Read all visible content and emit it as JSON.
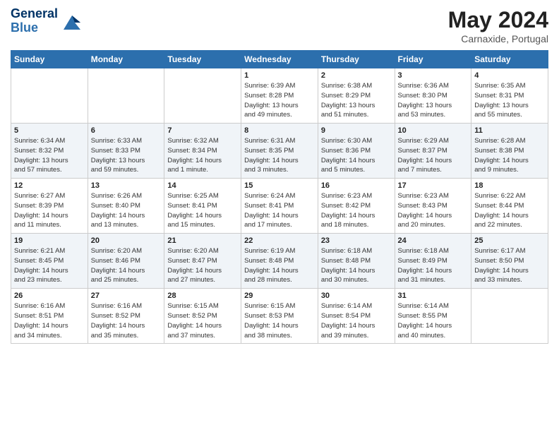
{
  "header": {
    "logo_line1": "General",
    "logo_line2": "Blue",
    "month": "May 2024",
    "location": "Carnaxide, Portugal"
  },
  "days_of_week": [
    "Sunday",
    "Monday",
    "Tuesday",
    "Wednesday",
    "Thursday",
    "Friday",
    "Saturday"
  ],
  "weeks": [
    [
      {
        "day": "",
        "info": ""
      },
      {
        "day": "",
        "info": ""
      },
      {
        "day": "",
        "info": ""
      },
      {
        "day": "1",
        "info": "Sunrise: 6:39 AM\nSunset: 8:28 PM\nDaylight: 13 hours\nand 49 minutes."
      },
      {
        "day": "2",
        "info": "Sunrise: 6:38 AM\nSunset: 8:29 PM\nDaylight: 13 hours\nand 51 minutes."
      },
      {
        "day": "3",
        "info": "Sunrise: 6:36 AM\nSunset: 8:30 PM\nDaylight: 13 hours\nand 53 minutes."
      },
      {
        "day": "4",
        "info": "Sunrise: 6:35 AM\nSunset: 8:31 PM\nDaylight: 13 hours\nand 55 minutes."
      }
    ],
    [
      {
        "day": "5",
        "info": "Sunrise: 6:34 AM\nSunset: 8:32 PM\nDaylight: 13 hours\nand 57 minutes."
      },
      {
        "day": "6",
        "info": "Sunrise: 6:33 AM\nSunset: 8:33 PM\nDaylight: 13 hours\nand 59 minutes."
      },
      {
        "day": "7",
        "info": "Sunrise: 6:32 AM\nSunset: 8:34 PM\nDaylight: 14 hours\nand 1 minute."
      },
      {
        "day": "8",
        "info": "Sunrise: 6:31 AM\nSunset: 8:35 PM\nDaylight: 14 hours\nand 3 minutes."
      },
      {
        "day": "9",
        "info": "Sunrise: 6:30 AM\nSunset: 8:36 PM\nDaylight: 14 hours\nand 5 minutes."
      },
      {
        "day": "10",
        "info": "Sunrise: 6:29 AM\nSunset: 8:37 PM\nDaylight: 14 hours\nand 7 minutes."
      },
      {
        "day": "11",
        "info": "Sunrise: 6:28 AM\nSunset: 8:38 PM\nDaylight: 14 hours\nand 9 minutes."
      }
    ],
    [
      {
        "day": "12",
        "info": "Sunrise: 6:27 AM\nSunset: 8:39 PM\nDaylight: 14 hours\nand 11 minutes."
      },
      {
        "day": "13",
        "info": "Sunrise: 6:26 AM\nSunset: 8:40 PM\nDaylight: 14 hours\nand 13 minutes."
      },
      {
        "day": "14",
        "info": "Sunrise: 6:25 AM\nSunset: 8:41 PM\nDaylight: 14 hours\nand 15 minutes."
      },
      {
        "day": "15",
        "info": "Sunrise: 6:24 AM\nSunset: 8:41 PM\nDaylight: 14 hours\nand 17 minutes."
      },
      {
        "day": "16",
        "info": "Sunrise: 6:23 AM\nSunset: 8:42 PM\nDaylight: 14 hours\nand 18 minutes."
      },
      {
        "day": "17",
        "info": "Sunrise: 6:23 AM\nSunset: 8:43 PM\nDaylight: 14 hours\nand 20 minutes."
      },
      {
        "day": "18",
        "info": "Sunrise: 6:22 AM\nSunset: 8:44 PM\nDaylight: 14 hours\nand 22 minutes."
      }
    ],
    [
      {
        "day": "19",
        "info": "Sunrise: 6:21 AM\nSunset: 8:45 PM\nDaylight: 14 hours\nand 23 minutes."
      },
      {
        "day": "20",
        "info": "Sunrise: 6:20 AM\nSunset: 8:46 PM\nDaylight: 14 hours\nand 25 minutes."
      },
      {
        "day": "21",
        "info": "Sunrise: 6:20 AM\nSunset: 8:47 PM\nDaylight: 14 hours\nand 27 minutes."
      },
      {
        "day": "22",
        "info": "Sunrise: 6:19 AM\nSunset: 8:48 PM\nDaylight: 14 hours\nand 28 minutes."
      },
      {
        "day": "23",
        "info": "Sunrise: 6:18 AM\nSunset: 8:48 PM\nDaylight: 14 hours\nand 30 minutes."
      },
      {
        "day": "24",
        "info": "Sunrise: 6:18 AM\nSunset: 8:49 PM\nDaylight: 14 hours\nand 31 minutes."
      },
      {
        "day": "25",
        "info": "Sunrise: 6:17 AM\nSunset: 8:50 PM\nDaylight: 14 hours\nand 33 minutes."
      }
    ],
    [
      {
        "day": "26",
        "info": "Sunrise: 6:16 AM\nSunset: 8:51 PM\nDaylight: 14 hours\nand 34 minutes."
      },
      {
        "day": "27",
        "info": "Sunrise: 6:16 AM\nSunset: 8:52 PM\nDaylight: 14 hours\nand 35 minutes."
      },
      {
        "day": "28",
        "info": "Sunrise: 6:15 AM\nSunset: 8:52 PM\nDaylight: 14 hours\nand 37 minutes."
      },
      {
        "day": "29",
        "info": "Sunrise: 6:15 AM\nSunset: 8:53 PM\nDaylight: 14 hours\nand 38 minutes."
      },
      {
        "day": "30",
        "info": "Sunrise: 6:14 AM\nSunset: 8:54 PM\nDaylight: 14 hours\nand 39 minutes."
      },
      {
        "day": "31",
        "info": "Sunrise: 6:14 AM\nSunset: 8:55 PM\nDaylight: 14 hours\nand 40 minutes."
      },
      {
        "day": "",
        "info": ""
      }
    ]
  ]
}
